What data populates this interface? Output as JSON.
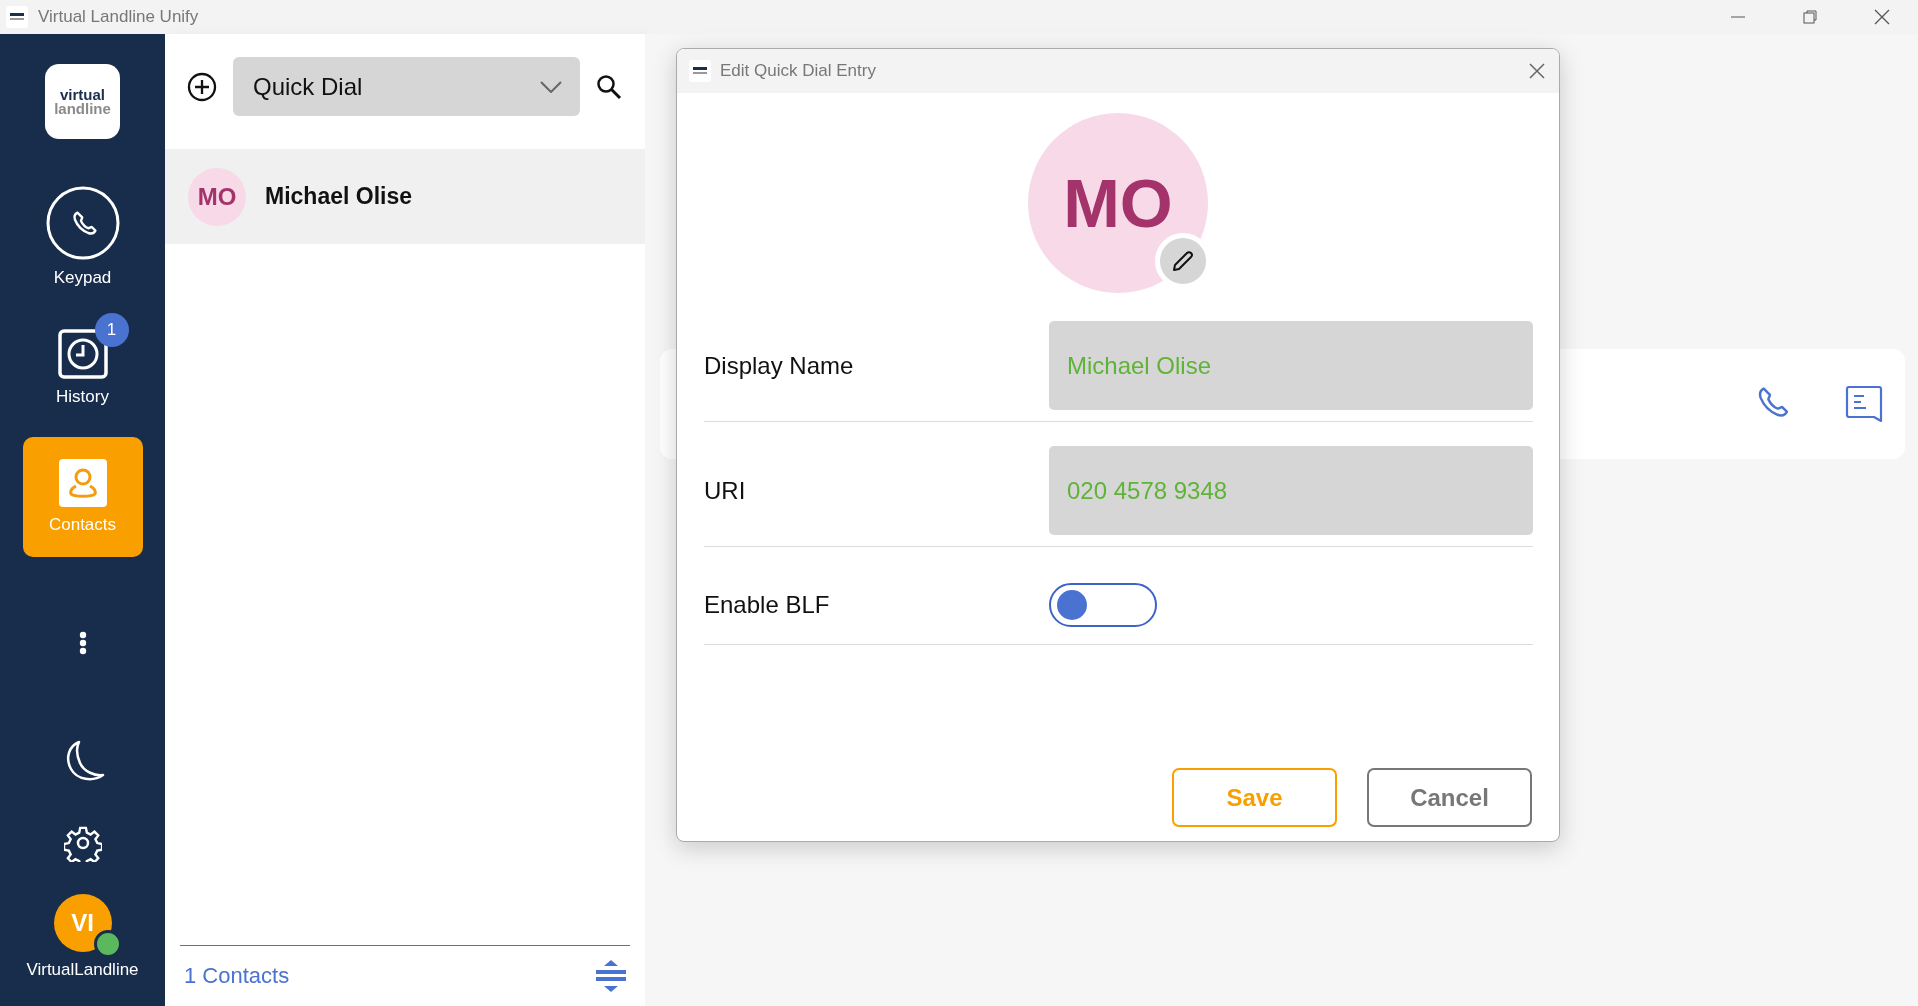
{
  "window": {
    "title": "Virtual Landline Unify"
  },
  "sidebar": {
    "logo": {
      "line_1": "virtual",
      "line_2": "landline"
    },
    "items": [
      {
        "kind": "keypad",
        "label": "Keypad",
        "selected": false
      },
      {
        "kind": "history",
        "label": "History",
        "badge": "1",
        "selected": false
      },
      {
        "kind": "contacts",
        "label": "Contacts",
        "selected": true
      }
    ],
    "user": {
      "initials": "VI",
      "name": "VirtualLandline",
      "online": true
    }
  },
  "contacts": {
    "filter": "Quick Dial",
    "items": [
      {
        "initials": "MO",
        "name": "Michael Olise",
        "selected": true
      }
    ],
    "count": "1 Contacts"
  },
  "dialog": {
    "title": "Edit Quick Dial Entry",
    "initials": "MO",
    "fields": [
      {
        "kind": "text",
        "label": "Display Name",
        "value": "Michael Olise"
      },
      {
        "kind": "text",
        "label": "URI",
        "value": "020 4578 9348"
      },
      {
        "kind": "toggle",
        "label": "Enable BLF",
        "on": false
      }
    ],
    "buttons": [
      {
        "kind": "primary",
        "label": "Save"
      },
      {
        "kind": "secondary",
        "label": "Cancel"
      }
    ]
  }
}
